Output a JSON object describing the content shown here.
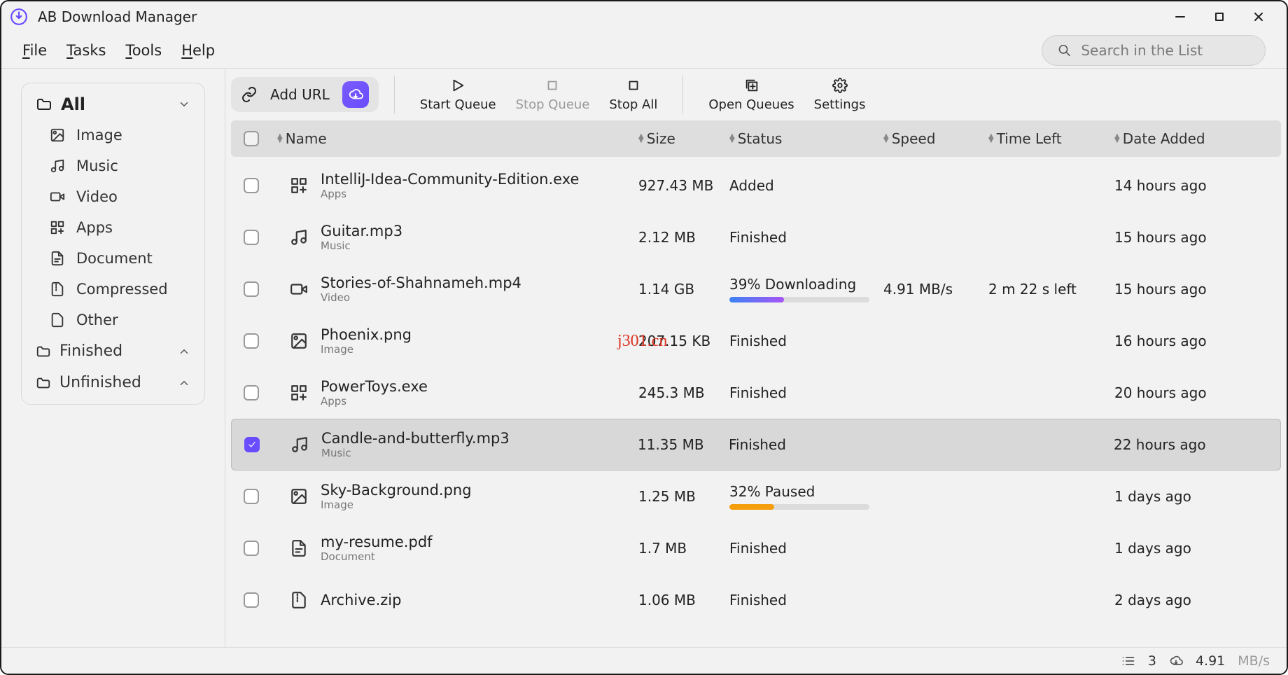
{
  "app_title": "AB Download Manager",
  "menu": {
    "file": "File",
    "tasks": "Tasks",
    "tools": "Tools",
    "help": "Help"
  },
  "search": {
    "placeholder": "Search in the List"
  },
  "toolbar": {
    "add_url": "Add URL",
    "start_queue": "Start Queue",
    "stop_queue": "Stop Queue",
    "stop_all": "Stop All",
    "open_queues": "Open Queues",
    "settings": "Settings"
  },
  "sidebar": {
    "all": "All",
    "categories": [
      "Image",
      "Music",
      "Video",
      "Apps",
      "Document",
      "Compressed",
      "Other"
    ],
    "finished": "Finished",
    "unfinished": "Unfinished"
  },
  "columns": {
    "name": "Name",
    "size": "Size",
    "status": "Status",
    "speed": "Speed",
    "time_left": "Time Left",
    "date_added": "Date Added"
  },
  "rows": [
    {
      "icon": "apps",
      "name": "IntelliJ-Idea-Community-Edition.exe",
      "cat": "Apps",
      "size": "927.43 MB",
      "status": "Added",
      "speed": "",
      "time_left": "",
      "date": "14 hours ago",
      "selected": false
    },
    {
      "icon": "music",
      "name": "Guitar.mp3",
      "cat": "Music",
      "size": "2.12 MB",
      "status": "Finished",
      "speed": "",
      "time_left": "",
      "date": "15 hours ago",
      "selected": false
    },
    {
      "icon": "video",
      "name": "Stories-of-Shahnameh.mp4",
      "cat": "Video",
      "size": "1.14 GB",
      "status": "39% Downloading",
      "speed": "4.91 MB/s",
      "time_left": "2 m 22 s left",
      "date": "15 hours ago",
      "selected": false,
      "progress": 39,
      "ptype": "dl"
    },
    {
      "icon": "image",
      "name": "Phoenix.png",
      "cat": "Image",
      "size": "207.15 KB",
      "status": "Finished",
      "speed": "",
      "time_left": "",
      "date": "16 hours ago",
      "selected": false
    },
    {
      "icon": "apps",
      "name": "PowerToys.exe",
      "cat": "Apps",
      "size": "245.3 MB",
      "status": "Finished",
      "speed": "",
      "time_left": "",
      "date": "20 hours ago",
      "selected": false
    },
    {
      "icon": "music",
      "name": "Candle-and-butterfly.mp3",
      "cat": "Music",
      "size": "11.35 MB",
      "status": "Finished",
      "speed": "",
      "time_left": "",
      "date": "22 hours ago",
      "selected": true
    },
    {
      "icon": "image",
      "name": "Sky-Background.png",
      "cat": "Image",
      "size": "1.25 MB",
      "status": "32% Paused",
      "speed": "",
      "time_left": "",
      "date": "1 days ago",
      "selected": false,
      "progress": 32,
      "ptype": "paused"
    },
    {
      "icon": "document",
      "name": "my-resume.pdf",
      "cat": "Document",
      "size": "1.7 MB",
      "status": "Finished",
      "speed": "",
      "time_left": "",
      "date": "1 days ago",
      "selected": false
    },
    {
      "icon": "compressed",
      "name": "Archive.zip",
      "cat": "",
      "size": "1.06 MB",
      "status": "Finished",
      "speed": "",
      "time_left": "",
      "date": "2 days ago",
      "selected": false
    }
  ],
  "statusbar": {
    "count": "3",
    "speed": "4.91",
    "unit": "MB/s"
  },
  "watermark": "j301.cn"
}
